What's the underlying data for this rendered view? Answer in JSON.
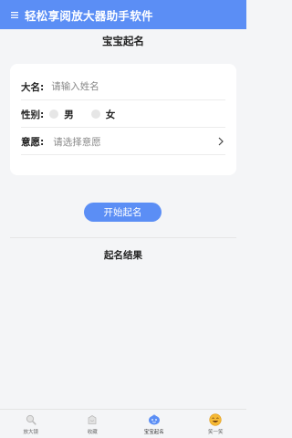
{
  "app": {
    "title": "轻松享阅放大器助手软件"
  },
  "page": {
    "title": "宝宝起名"
  },
  "form": {
    "name_label": "大名:",
    "name_placeholder": "请输入姓名",
    "gender_label": "性别:",
    "gender_options": [
      "男",
      "女"
    ],
    "wish_label": "意愿:",
    "wish_placeholder": "请选择意愿"
  },
  "start_button": "开始起名",
  "result": {
    "title": "起名结果"
  },
  "tabbar": {
    "items": [
      {
        "label": "放大镜",
        "icon": "magnifier-icon",
        "active": false
      },
      {
        "label": "收藏",
        "icon": "favorites-icon",
        "active": false
      },
      {
        "label": "宝宝起名",
        "icon": "baby-name-icon",
        "active": true
      },
      {
        "label": "笑一笑",
        "icon": "smile-icon",
        "active": false
      }
    ]
  },
  "colors": {
    "accent": "#5b8ef5",
    "background": "#f4f5f7",
    "card": "#ffffff"
  }
}
